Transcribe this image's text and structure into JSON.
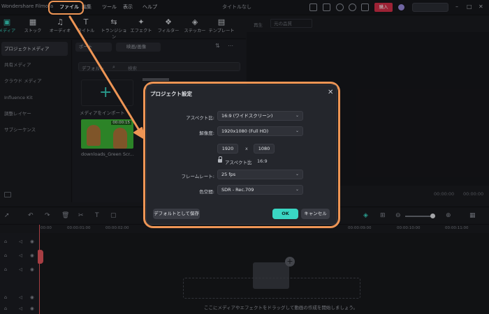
{
  "app": {
    "name": "Wondershare Filmora",
    "window_title": "タイトルなし",
    "menus": [
      "ファイル",
      "編集",
      "ツール",
      "表示",
      "ヘルプ"
    ],
    "buy_label": "購入"
  },
  "tabs": [
    {
      "label": "メディア",
      "icon": "media-icon"
    },
    {
      "label": "ストック",
      "icon": "stock-icon"
    },
    {
      "label": "オーディオ",
      "icon": "audio-icon"
    },
    {
      "label": "タイトル",
      "icon": "title-icon"
    },
    {
      "label": "トランジション",
      "icon": "transition-icon"
    },
    {
      "label": "エフェクト",
      "icon": "effect-icon"
    },
    {
      "label": "フィルター",
      "icon": "filter-icon"
    },
    {
      "label": "ステッカー",
      "icon": "sticker-icon"
    },
    {
      "label": "テンプレート",
      "icon": "template-icon"
    }
  ],
  "sidebar": {
    "items": [
      "プロジェクトメディア",
      "共有メディア",
      "クラウド メディア",
      "Influence Kit",
      "調整レイヤー",
      "サブシーケンス"
    ]
  },
  "media": {
    "import_menu": "ポート",
    "filter_label": "映画/画像",
    "folder_label": "デフォルト",
    "search_placeholder": "検索",
    "import_label": "メディアをインポート",
    "clip_name": "downloads_Green Scr...",
    "clip_duration": "00:00:15"
  },
  "preview": {
    "label": "再生",
    "quality": "元の品質",
    "time_current": "00:00:00",
    "time_total": "00:00:00"
  },
  "timeline": {
    "ticks": [
      "00:00",
      "00:00:01:00",
      "00:00:02:00",
      "00:00:09:00",
      "00:00:10:00",
      "00:00:11:00"
    ],
    "drop_hint": "ここにメディアやエフェクトをドラッグして動画の作成を開始しましょう。"
  },
  "dialog": {
    "title": "プロジェクト設定",
    "aspect_label": "アスペクト比:",
    "aspect_value": "16:9 (ワイドスクリーン)",
    "resolution_label": "解像度:",
    "resolution_value": "1920x1080 (Full HD)",
    "width": "1920",
    "height": "1080",
    "times": "x",
    "aspect_lock_label": "アスペクト比",
    "aspect_lock_value": "16:9",
    "framerate_label": "フレームレート:",
    "framerate_value": "25 fps",
    "colorspace_label": "色空間:",
    "colorspace_value": "SDR - Rec.709",
    "save_default_label": "デフォルトとして保存",
    "ok_label": "OK",
    "cancel_label": "キャンセル"
  },
  "colors": {
    "accent": "#3ad6c3",
    "highlight": "#ee9555",
    "buy": "#d9304a"
  }
}
